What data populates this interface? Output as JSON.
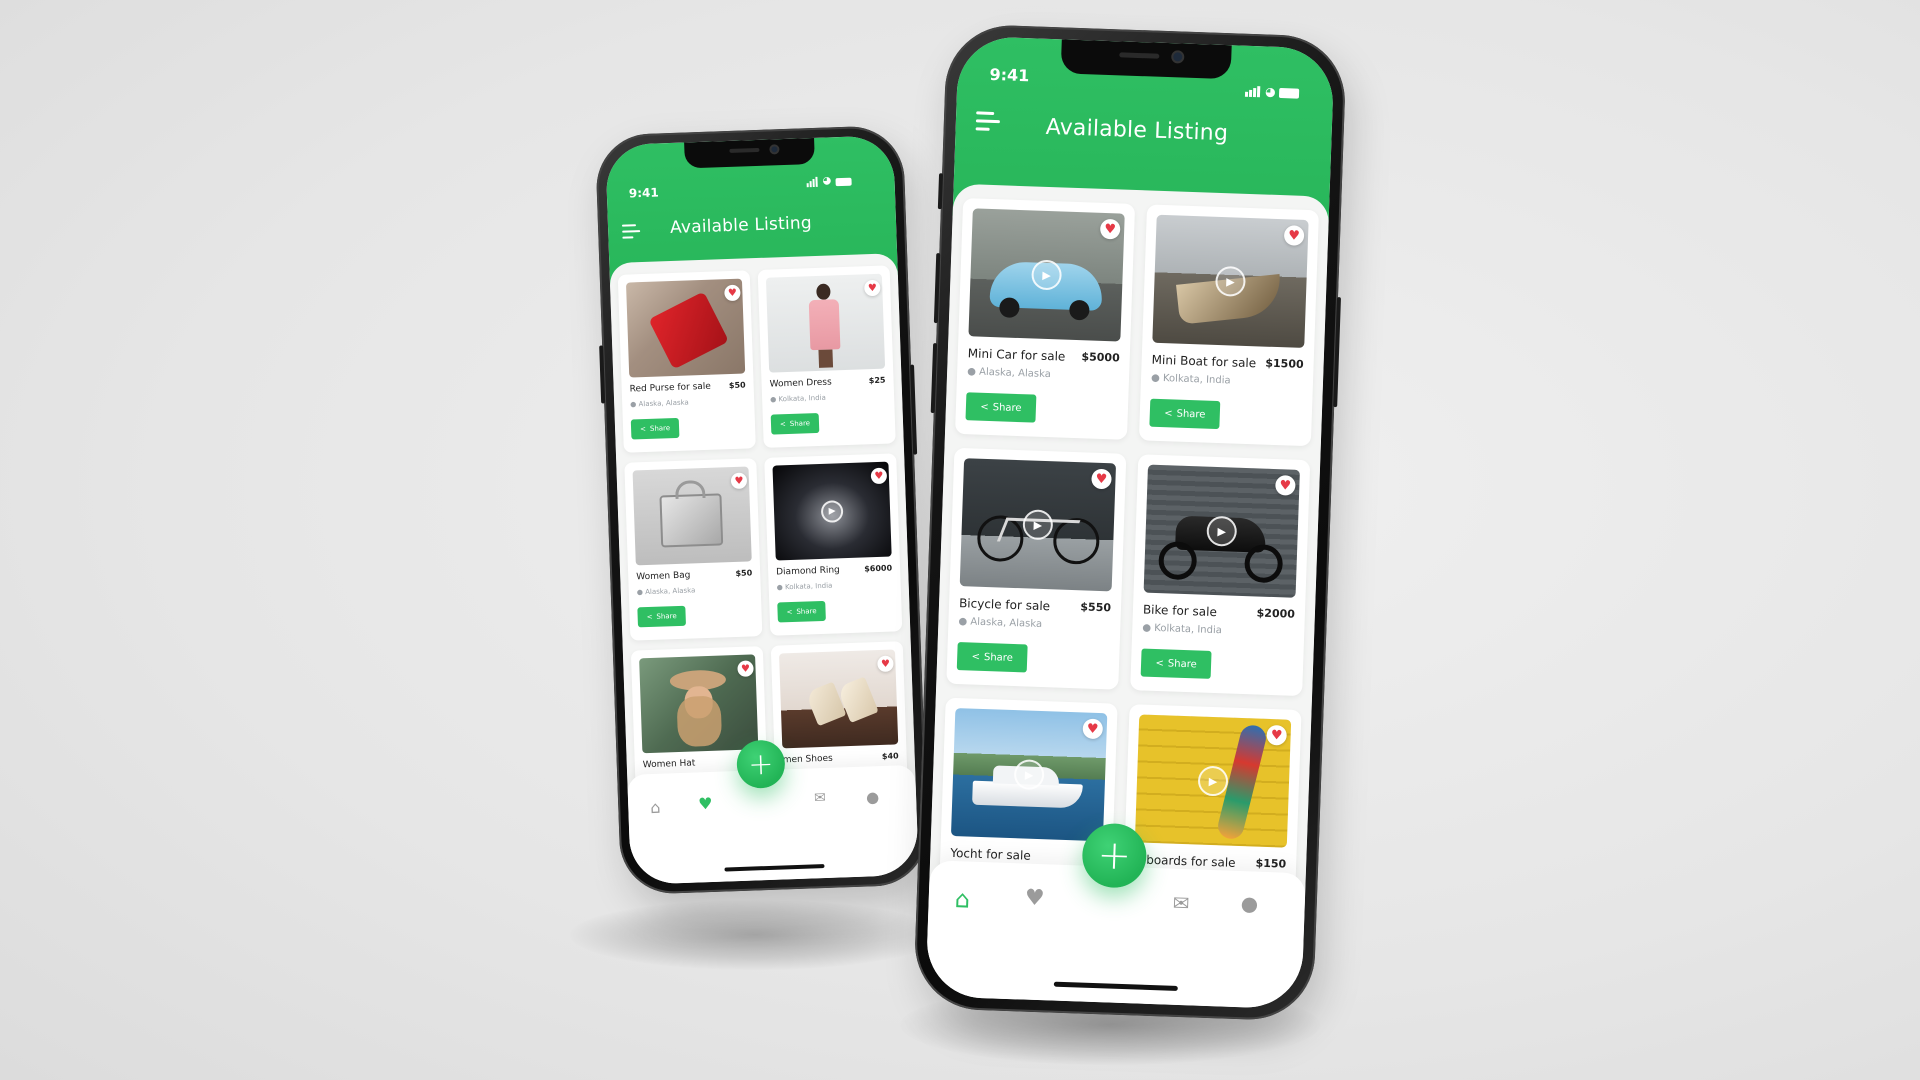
{
  "background": "#e8e8e8",
  "accent": "#2fbf63",
  "heart_color": "#e63946",
  "left_phone": {
    "time": "9:41",
    "title": "Available Listing",
    "listings": [
      {
        "name": "Red Purse for sale",
        "price": "$50",
        "location": "Alaska, Alaska",
        "share": "Share",
        "image": "red-purse",
        "video": false
      },
      {
        "name": "Women Dress",
        "price": "$25",
        "location": "Kolkata, India",
        "share": "Share",
        "image": "pink-dress",
        "video": false
      },
      {
        "name": "Women Bag",
        "price": "$50",
        "location": "Alaska, Alaska",
        "share": "Share",
        "image": "grey-bag",
        "video": false
      },
      {
        "name": "Diamond Ring",
        "price": "$6000",
        "location": "Kolkata, India",
        "share": "Share",
        "image": "diamond-ring",
        "video": true
      },
      {
        "name": "Women Hat",
        "price": "$",
        "location": "",
        "share": "",
        "image": "women-hat",
        "video": false
      },
      {
        "name": "men Shoes",
        "price": "$40",
        "location": "",
        "share": "",
        "image": "heels",
        "video": false
      }
    ],
    "nav": [
      "home-icon",
      "heart-icon",
      "add-icon",
      "mail-icon",
      "profile-icon"
    ],
    "fab": "+"
  },
  "right_phone": {
    "time": "9:41",
    "title": "Available Listing",
    "listings": [
      {
        "name": "Mini Car for sale",
        "price": "$5000",
        "location": "Alaska, Alaska",
        "share": "Share",
        "image": "blue-car",
        "video": true
      },
      {
        "name": "Mini Boat for sale",
        "price": "$1500",
        "location": "Kolkata, India",
        "share": "Share",
        "image": "old-boat",
        "video": true
      },
      {
        "name": "Bicycle for sale",
        "price": "$550",
        "location": "Alaska, Alaska",
        "share": "Share",
        "image": "bicycle",
        "video": true
      },
      {
        "name": "Bike for sale",
        "price": "$2000",
        "location": "Kolkata, India",
        "share": "Share",
        "image": "motorbike",
        "video": true
      },
      {
        "name": "Yocht for sale",
        "price": "$",
        "location": "",
        "share": "",
        "image": "yacht",
        "video": true
      },
      {
        "name": "boards for sale",
        "price": "$150",
        "location": "",
        "share": "",
        "image": "skateboard",
        "video": true
      }
    ],
    "nav": [
      "home-icon",
      "heart-icon",
      "add-icon",
      "mail-icon",
      "profile-icon"
    ],
    "fab": "+"
  }
}
